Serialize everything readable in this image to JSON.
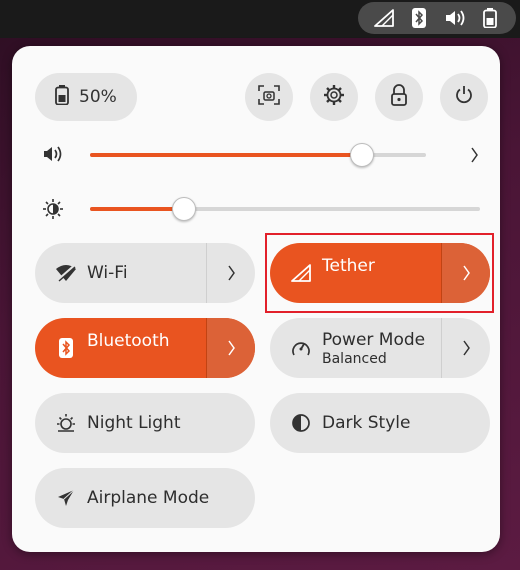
{
  "status": {
    "battery": "50%"
  },
  "sliders": {
    "volume": 0.81,
    "brightness": 0.24
  },
  "tiles": {
    "wifi": {
      "label": "Wi-Fi"
    },
    "tether": {
      "label": "Tether"
    },
    "bluetooth": {
      "label": "Bluetooth"
    },
    "power_mode": {
      "label": "Power Mode",
      "sub": "Balanced"
    },
    "night_light": {
      "label": "Night Light"
    },
    "dark_style": {
      "label": "Dark Style"
    },
    "airplane_mode": {
      "label": "Airplane Mode"
    }
  },
  "colors": {
    "accent": "#e95420",
    "highlight": "#e2202a"
  }
}
